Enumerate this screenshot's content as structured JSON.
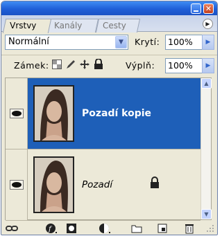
{
  "tabs": [
    {
      "label": "Vrstvy"
    },
    {
      "label": "Kanály"
    },
    {
      "label": "Cesty"
    }
  ],
  "blend": {
    "mode": "Normální",
    "opacity_label": "Krytí:",
    "opacity_value": "100%"
  },
  "lock": {
    "label": "Zámek:",
    "fill_label": "Výplň:",
    "fill_value": "100%"
  },
  "layers": [
    {
      "name": "Pozadí kopie",
      "selected": true
    },
    {
      "name": "Pozadí",
      "selected": false,
      "locked": true
    }
  ],
  "colors": {
    "selection": "#1e5fb8",
    "panel_bg": "#ece9d8",
    "titlebar": "#1f5fd8"
  }
}
